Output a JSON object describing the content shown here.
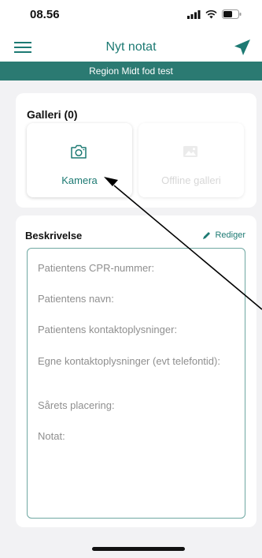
{
  "status_bar": {
    "time": "08.56"
  },
  "header": {
    "title": "Nyt notat",
    "menu_icon": "hamburger-menu-icon",
    "send_icon": "send-icon"
  },
  "banner": {
    "text": "Region Midt fod test"
  },
  "gallery": {
    "title": "Galleri (0)",
    "camera_label": "Kamera",
    "offline_label": "Offline galleri"
  },
  "description": {
    "title": "Beskrivelse",
    "edit_label": "Rediger",
    "fields": [
      "Patientens CPR-nummer:",
      "Patientens navn:",
      "Patientens kontaktoplysninger:",
      "Egne kontaktoplysninger (evt telefontid):",
      "Sårets placering:",
      "Notat:"
    ]
  },
  "colors": {
    "accent": "#1d7a73",
    "banner": "#2b7a72",
    "background": "#f2f2f4"
  }
}
